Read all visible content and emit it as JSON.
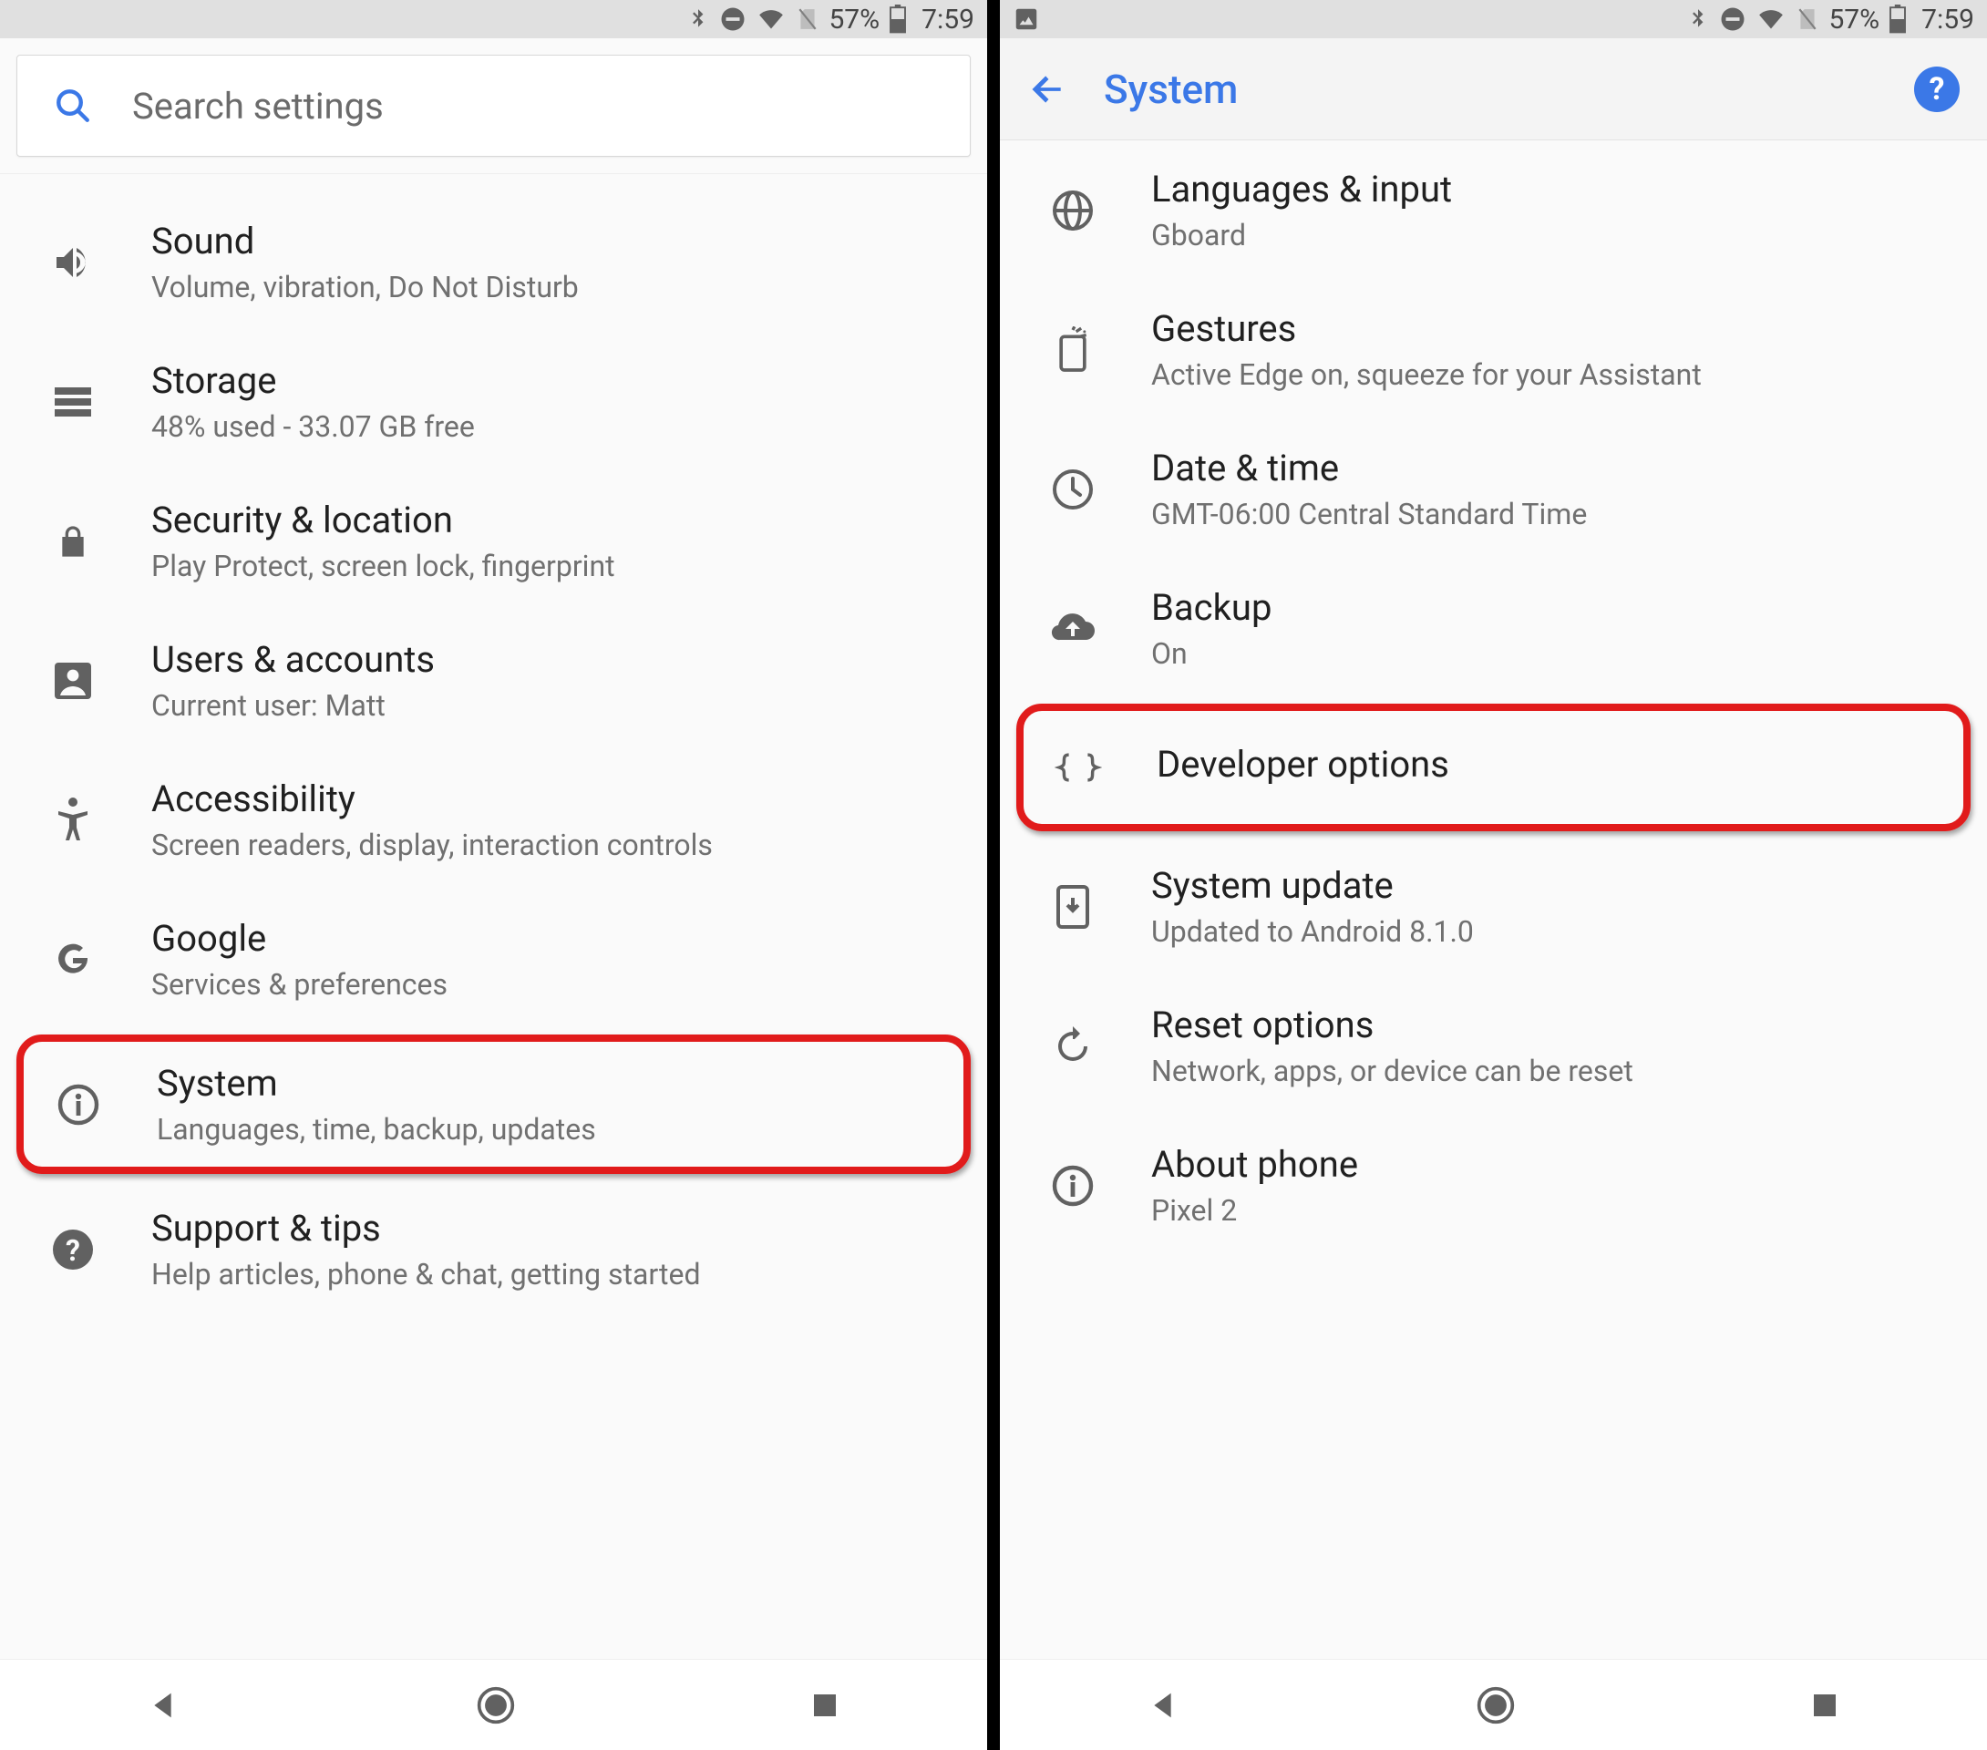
{
  "status": {
    "battery_pct": "57%",
    "time": "7:59"
  },
  "left": {
    "search_placeholder": "Search settings",
    "items": [
      {
        "icon": "sound",
        "title": "Sound",
        "subtitle": "Volume, vibration, Do Not Disturb"
      },
      {
        "icon": "storage",
        "title": "Storage",
        "subtitle": "48% used - 33.07 GB free"
      },
      {
        "icon": "lock",
        "title": "Security & location",
        "subtitle": "Play Protect, screen lock, fingerprint"
      },
      {
        "icon": "person",
        "title": "Users & accounts",
        "subtitle": "Current user: Matt"
      },
      {
        "icon": "accessibility",
        "title": "Accessibility",
        "subtitle": "Screen readers, display, interaction controls"
      },
      {
        "icon": "google",
        "title": "Google",
        "subtitle": "Services & preferences"
      },
      {
        "icon": "info",
        "title": "System",
        "subtitle": "Languages, time, backup, updates",
        "highlight": true
      },
      {
        "icon": "help",
        "title": "Support & tips",
        "subtitle": "Help articles, phone & chat, getting started"
      }
    ]
  },
  "right": {
    "header_title": "System",
    "items": [
      {
        "icon": "globe",
        "title": "Languages & input",
        "subtitle": "Gboard"
      },
      {
        "icon": "gestures",
        "title": "Gestures",
        "subtitle": "Active Edge on, squeeze for your Assistant"
      },
      {
        "icon": "clock",
        "title": "Date & time",
        "subtitle": "GMT-06:00 Central Standard Time"
      },
      {
        "icon": "backup",
        "title": "Backup",
        "subtitle": "On"
      },
      {
        "icon": "braces",
        "title": "Developer options",
        "subtitle": "",
        "highlight": true
      },
      {
        "icon": "update",
        "title": "System update",
        "subtitle": "Updated to Android 8.1.0"
      },
      {
        "icon": "reset",
        "title": "Reset options",
        "subtitle": "Network, apps, or device can be reset"
      },
      {
        "icon": "info",
        "title": "About phone",
        "subtitle": "Pixel 2"
      }
    ]
  }
}
